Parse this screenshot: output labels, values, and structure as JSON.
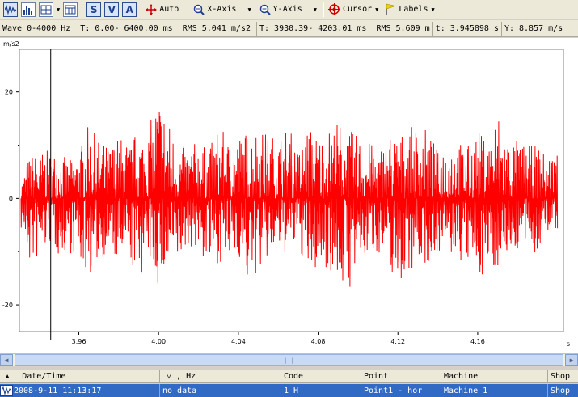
{
  "toolbar": {
    "auto_label": "Auto",
    "xaxis_label": "X-Axis",
    "yaxis_label": "Y-Axis",
    "cursor_label": "Cursor",
    "labels_label": "Labels",
    "s_icon_text": "S",
    "v_icon_text": "V",
    "a_icon_text": "A"
  },
  "status": {
    "wave": "Wave 0-4000 Hz",
    "time_range": "T: 0.00- 6400.00 ms",
    "rms_total": "RMS 5.041 m/s2",
    "sel_range": "T: 3930.39- 4203.01 ms",
    "rms_sel": "RMS 5.609 m",
    "cursor_t": "t: 3.945898 s",
    "cursor_y": "Y:  8.857 m/s"
  },
  "chart_data": {
    "type": "line",
    "title": "",
    "ylabel": "m/s2",
    "xlabel": "",
    "xlim": [
      3.9302,
      4.203
    ],
    "ylim": [
      -25,
      28
    ],
    "x_ticks": [
      "3.96",
      "4.00",
      "4.04",
      "4.08",
      "4.12",
      "4.16",
      "s"
    ],
    "x_tick_values": [
      3.96,
      4.0,
      4.04,
      4.08,
      4.12,
      4.16
    ],
    "y_ticks": [
      "20",
      "0",
      "-20"
    ],
    "y_tick_values": [
      20,
      0,
      -20
    ],
    "cursor_x": 3.945898,
    "series": [
      {
        "color": "#ff0000",
        "x": [
          3.931,
          3.935,
          3.94,
          3.945,
          3.95,
          3.955,
          3.96,
          3.965,
          3.97,
          3.975,
          3.98,
          3.985,
          3.99,
          3.995,
          4.0,
          4.005,
          4.01,
          4.015,
          4.02,
          4.025,
          4.03,
          4.035,
          4.04,
          4.045,
          4.05,
          4.055,
          4.06,
          4.065,
          4.07,
          4.075,
          4.08,
          4.085,
          4.09,
          4.095,
          4.1,
          4.105,
          4.11,
          4.115,
          4.12,
          4.125,
          4.13,
          4.135,
          4.14,
          4.145,
          4.15,
          4.155,
          4.16,
          4.165,
          4.17,
          4.175,
          4.18,
          4.185,
          4.19,
          4.195,
          4.2
        ],
        "upper": [
          3,
          8,
          9,
          9,
          9,
          7,
          9,
          14,
          11,
          10,
          12,
          11,
          13,
          13,
          21,
          15,
          10,
          10,
          11,
          9,
          14,
          11,
          12,
          13,
          14,
          12,
          12,
          14,
          9,
          14,
          12,
          13,
          15,
          13,
          12,
          11,
          9,
          13,
          12,
          13,
          14,
          13,
          9,
          12,
          11,
          10,
          13,
          11,
          17,
          12,
          11,
          10,
          10,
          8,
          10
        ],
        "lower": [
          -6,
          -13,
          -12,
          -9,
          -11,
          -10,
          -12,
          -15,
          -12,
          -10,
          -13,
          -12,
          -16,
          -12,
          -17,
          -15,
          -13,
          -9,
          -10,
          -14,
          -12,
          -13,
          -11,
          -17,
          -14,
          -12,
          -10,
          -11,
          -9,
          -15,
          -14,
          -13,
          -16,
          -18,
          -14,
          -11,
          -10,
          -13,
          -17,
          -14,
          -12,
          -13,
          -10,
          -11,
          -12,
          -13,
          -15,
          -14,
          -13,
          -11,
          -10,
          -9,
          -11,
          -7,
          -6
        ]
      }
    ]
  },
  "scrollbar": {
    "left_arrow": "◀",
    "right_arrow": "▶",
    "thumb_grip": "|||"
  },
  "table": {
    "headers": [
      "Date/Time",
      "▽ , Hz",
      "Code",
      "Point",
      "Machine",
      "Shop"
    ],
    "row": [
      "2008-9-11 11:13:17",
      "no data",
      "1 H",
      "Point1 - hor",
      "Machine 1",
      "Shop"
    ]
  }
}
